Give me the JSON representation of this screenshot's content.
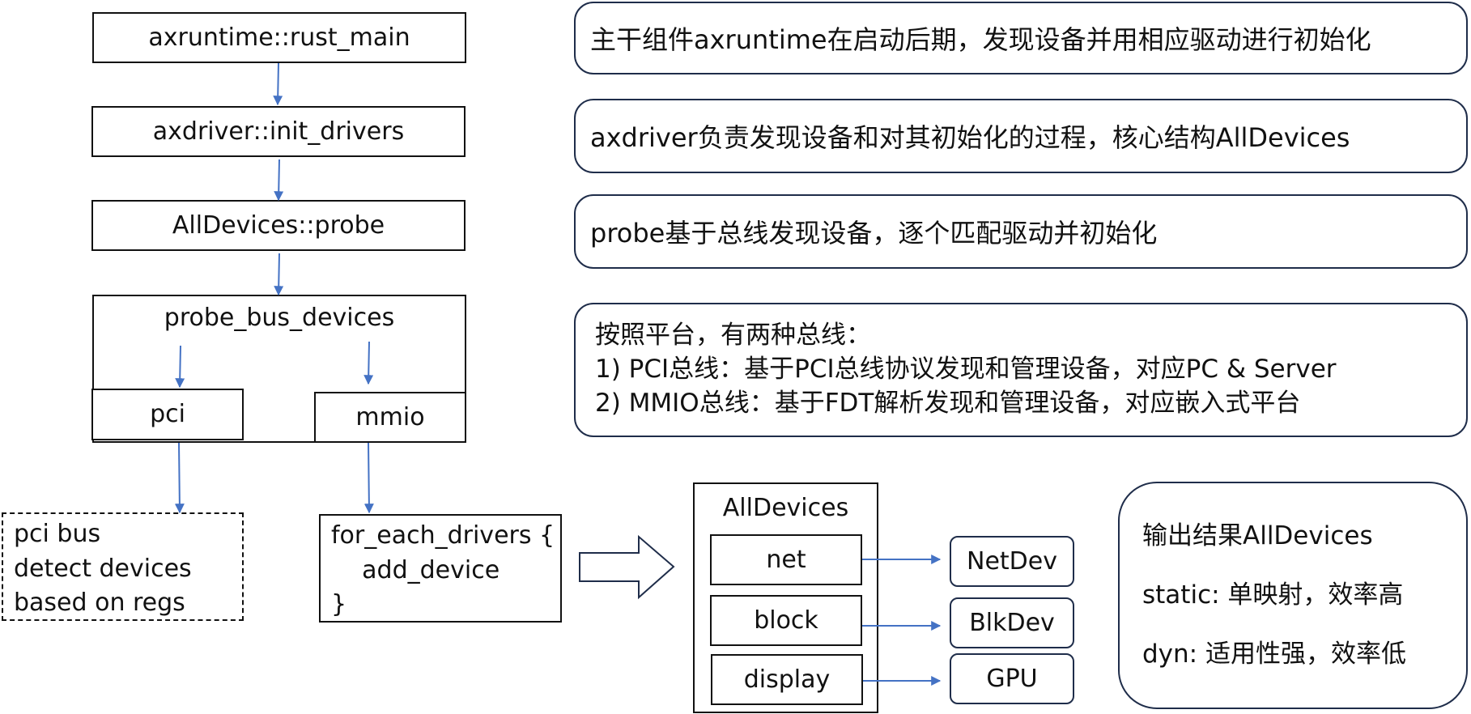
{
  "flow": {
    "rust_main": "axruntime::rust_main",
    "init_drivers": "axdriver::init_drivers",
    "probe": "AllDevices::probe",
    "probe_bus_devices": "probe_bus_devices",
    "pci": "pci",
    "mmio": "mmio"
  },
  "pci_bus": [
    "pci bus",
    "detect devices",
    "based on regs"
  ],
  "for_each": [
    "for_each_drivers {",
    "    add_device",
    "}"
  ],
  "all_devices": {
    "title": "AllDevices",
    "slots": [
      "net",
      "block",
      "display"
    ],
    "targets": [
      "NetDev",
      "BlkDev",
      "GPU"
    ]
  },
  "notes": {
    "n1": "主干组件axruntime在启动后期，发现设备并用相应驱动进行初始化",
    "n2": "axdriver负责发现设备和对其初始化的过程，核心结构AllDevices",
    "n3": "probe基于总线发现设备，逐个匹配驱动并初始化",
    "n4": [
      "按照平台，有两种总线：",
      "1) PCI总线：基于PCI总线协议发现和管理设备，对应PC & Server",
      "2) MMIO总线：基于FDT解析发现和管理设备，对应嵌入式平台"
    ],
    "n5": [
      "输出结果AllDevices",
      "static: 单映射，效率高",
      "dyn: 适用性强，效率低"
    ]
  },
  "colors": {
    "arrow": "#4472c4",
    "note_border": "#1f2d4a",
    "box_border": "#111111"
  }
}
